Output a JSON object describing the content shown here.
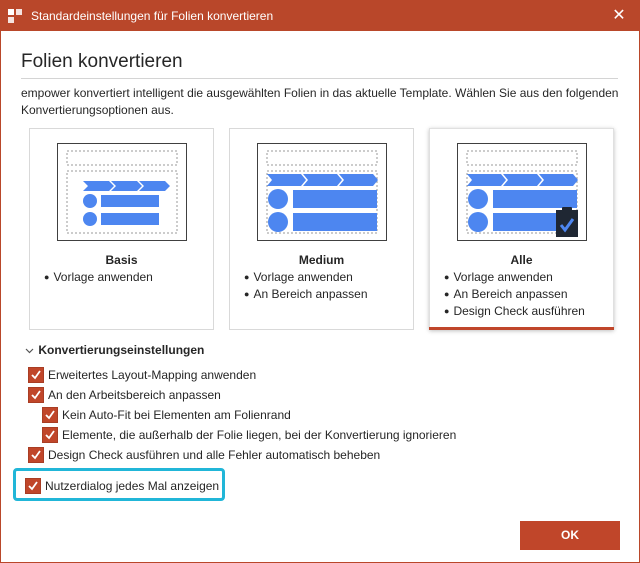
{
  "window": {
    "title": "Standardeinstellungen für Folien konvertieren",
    "close_glyph": "✕"
  },
  "heading": "Folien konvertieren",
  "description": "empower konvertiert intelligent die ausgewählten Folien in das aktuelle Template. Wählen Sie aus den folgenden Konvertierungsoptionen aus.",
  "options": [
    {
      "title": "Basis",
      "bullets": [
        "Vorlage anwenden"
      ],
      "selected": false
    },
    {
      "title": "Medium",
      "bullets": [
        "Vorlage anwenden",
        "An Bereich anpassen"
      ],
      "selected": false
    },
    {
      "title": "Alle",
      "bullets": [
        "Vorlage anwenden",
        "An Bereich anpassen",
        "Design Check ausführen"
      ],
      "selected": true
    }
  ],
  "settings": {
    "title": "Konvertierungseinstellungen",
    "checkboxes": [
      {
        "label": "Erweitertes Layout-Mapping anwenden",
        "checked": true
      },
      {
        "label": "An den Arbeitsbereich anpassen",
        "checked": true
      },
      {
        "label": "Kein Auto-Fit bei Elementen am Folienrand",
        "checked": true
      },
      {
        "label": "Elemente, die außerhalb der Folie liegen, bei der Konvertierung ignorieren",
        "checked": true
      },
      {
        "label": "Design Check ausführen und alle Fehler automatisch beheben",
        "checked": true
      }
    ]
  },
  "dialog_toggle": {
    "label": "Nutzerdialog jedes Mal anzeigen",
    "checked": true
  },
  "ok_label": "OK",
  "colors": {
    "accent": "#c0462a",
    "titlebar": "#b9472a",
    "shape_blue": "#4d86f0",
    "highlight": "#21b6d8"
  },
  "icons": {
    "app": "empower-app-icon",
    "check": "checkmark-icon",
    "clipboard": "clipboard-check-icon",
    "expand": "chevron-down-icon"
  }
}
